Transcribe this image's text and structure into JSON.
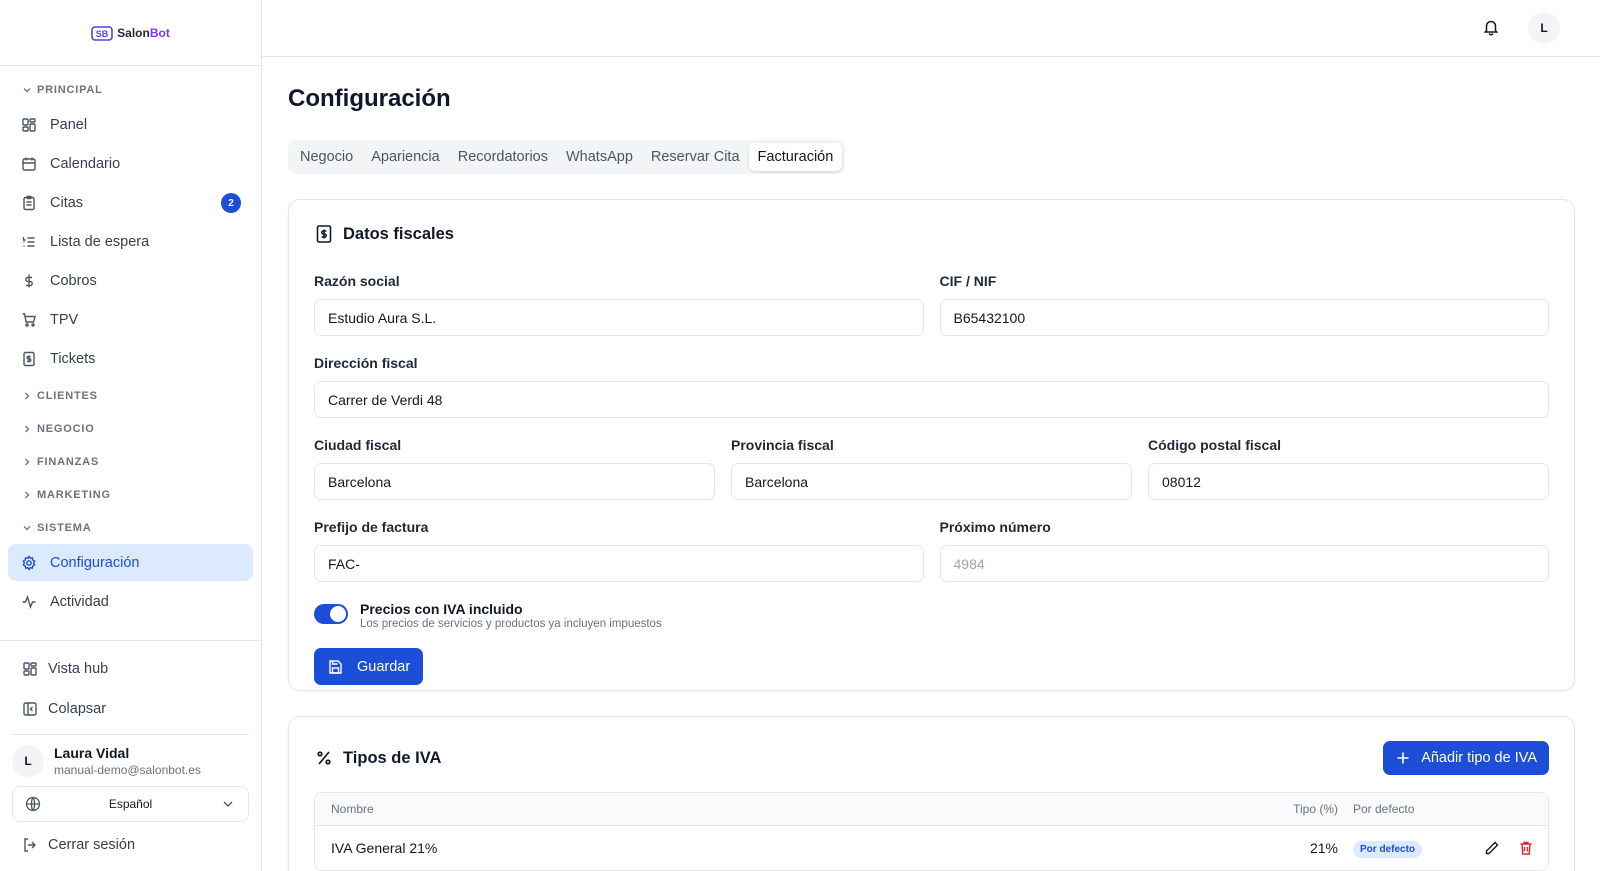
{
  "sidebar": {
    "logo": {
      "prefix": "Salon",
      "suffix": "Bot"
    },
    "sections": {
      "principal": "PRINCIPAL",
      "clientes": "CLIENTES",
      "negocio": "NEGOCIO",
      "finanzas": "FINANZAS",
      "marketing": "MARKETING",
      "sistema": "SISTEMA"
    },
    "items": {
      "panel": "Panel",
      "calendario": "Calendario",
      "citas": "Citas",
      "citas_badge": "2",
      "lista_espera": "Lista de espera",
      "cobros": "Cobros",
      "tpv": "TPV",
      "tickets": "Tickets",
      "configuracion": "Configuración",
      "actividad": "Actividad"
    },
    "bottom": {
      "vista_hub": "Vista hub",
      "colapsar": "Colapsar",
      "user_initial": "L",
      "user_name": "Laura Vidal",
      "user_email": "manual-demo@salonbot.es",
      "language": "Español",
      "logout": "Cerrar sesión"
    }
  },
  "topbar": {
    "avatar_initial": "L"
  },
  "main": {
    "title": "Configuración",
    "tabs": [
      "Negocio",
      "Apariencia",
      "Recordatorios",
      "WhatsApp",
      "Reservar Cita",
      "Facturación"
    ],
    "fiscal": {
      "title": "Datos fiscales",
      "razon_social_label": "Razón social",
      "razon_social_value": "Estudio Aura S.L.",
      "cif_label": "CIF / NIF",
      "cif_value": "B65432100",
      "direccion_label": "Dirección fiscal",
      "direccion_value": "Carrer de Verdi 48",
      "ciudad_label": "Ciudad fiscal",
      "ciudad_value": "Barcelona",
      "provincia_label": "Provincia fiscal",
      "provincia_value": "Barcelona",
      "cp_label": "Código postal fiscal",
      "cp_value": "08012",
      "prefijo_label": "Prefijo de factura",
      "prefijo_value": "FAC-",
      "proximo_label": "Próximo número",
      "proximo_placeholder": "4984",
      "iva_toggle_title": "Precios con IVA incluido",
      "iva_toggle_sub": "Los precios de servicios y productos ya incluyen impuestos",
      "iva_toggle_on": true,
      "save_label": "Guardar"
    },
    "iva": {
      "title": "Tipos de IVA",
      "add_label": "Añadir tipo de IVA",
      "headers": {
        "name": "Nombre",
        "rate": "Tipo (%)",
        "default": "Por defecto"
      },
      "rows": [
        {
          "name": "IVA General 21%",
          "rate": "21%",
          "default_badge": "Por defecto"
        }
      ]
    }
  },
  "colors": {
    "accent": "#1d4ed8",
    "accent_light": "#dbeafe",
    "danger": "#dc2626"
  }
}
